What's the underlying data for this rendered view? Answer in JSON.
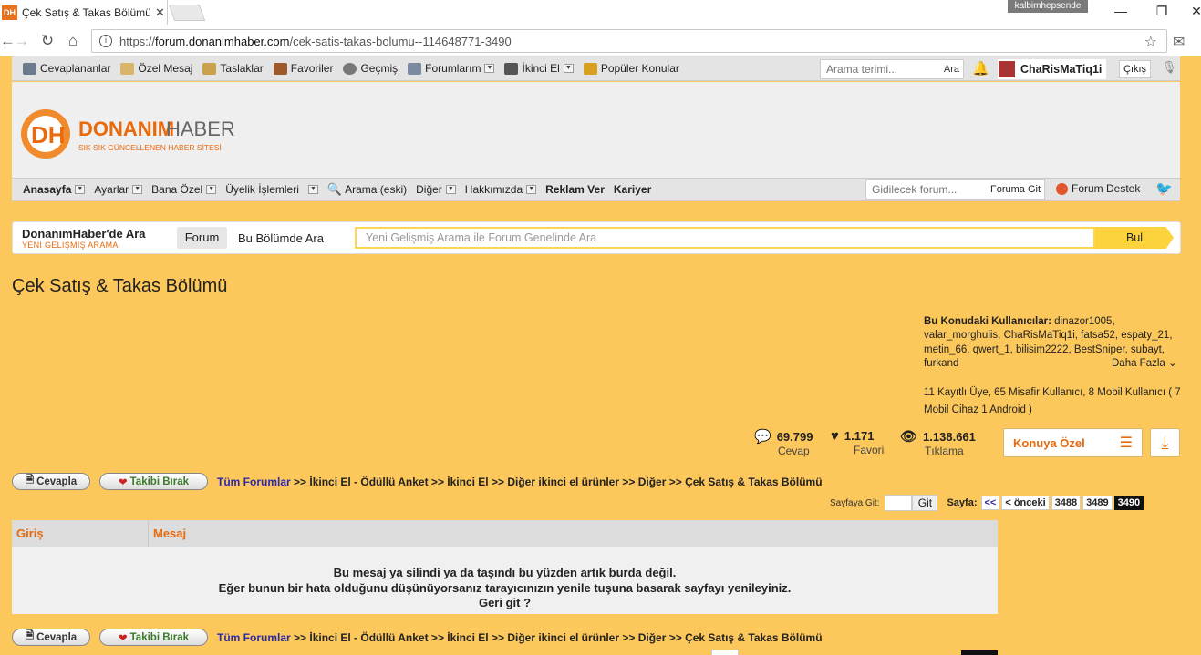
{
  "browser": {
    "tab_title": "Çek Satış & Takas Bölümü",
    "favicon_text": "DH",
    "profile_name": "kalbimhepsende",
    "url_scheme": "https://",
    "url_domain": "forum.donanimhaber.com",
    "url_path": "/cek-satis-takas-bolumu--114648771-3490"
  },
  "toplinks": [
    {
      "label": "Cevaplananlar"
    },
    {
      "label": "Özel Mesaj"
    },
    {
      "label": "Taslaklar"
    },
    {
      "label": "Favoriler"
    },
    {
      "label": "Geçmiş"
    },
    {
      "label": "Forumlarım"
    },
    {
      "label": "İkinci El"
    },
    {
      "label": "Popüler Konular"
    }
  ],
  "topbar": {
    "search_placeholder": "Arama terimi...",
    "search_button": "Ara",
    "username": "ChaRisMaTiq1i",
    "logout": "Çıkış"
  },
  "logo": {
    "brand_left": "DONANIM",
    "brand_right": "HABER",
    "tagline": "SIK SIK GÜNCELLENEN HABER SİTESİ"
  },
  "nav": [
    {
      "label": "Anasayfa"
    },
    {
      "label": "Ayarlar"
    },
    {
      "label": "Bana Özel"
    },
    {
      "label": "Üyelik İşlemleri"
    },
    {
      "label": "Arama (eski)"
    },
    {
      "label": "Diğer"
    },
    {
      "label": "Hakkımızda"
    },
    {
      "label": "Reklam Ver"
    },
    {
      "label": "Kariyer"
    }
  ],
  "goto_forum": {
    "placeholder": "Gidilecek forum...",
    "button": "Foruma Git"
  },
  "forum_support": "Forum Destek",
  "search": {
    "title": "DonanımHaber'de Ara",
    "subtitle": "YENİ GELİŞMİŞ ARAMA",
    "tab_forum": "Forum",
    "tab_section": "Bu Bölümde Ara",
    "placeholder": "Yeni Gelişmiş Arama ile Forum Genelinde Ara",
    "button": "Bul"
  },
  "page_title": "Çek Satış & Takas Bölümü",
  "online": {
    "label": "Bu Konudaki Kullanıcılar:",
    "users_text": "dinazor1005, valar_morghulis, ChaRisMaTiq1i, fatsa52, espaty_21, metin_66, qwert_1, bilisim2222, BestSniper, subayt, furkand",
    "more": "Daha Fazla",
    "counts": "11 Kayıtlı Üye, 65 Misafir Kullanıcı, 8 Mobil Kullanıcı ( 7 Mobil Cihaz 1 Android )"
  },
  "stats": {
    "replies_value": "69.799",
    "replies_label": "Cevap",
    "favorites_value": "1.171",
    "favorites_label": "Favori",
    "views_value": "1.138.661",
    "views_label": "Tıklama"
  },
  "topic_menu": "Konuya Özel",
  "actions": {
    "reply": "Cevapla",
    "unfollow": "Takibi Bırak"
  },
  "breadcrumb": {
    "first": "Tüm Forumlar",
    "rest": ">> İkinci El - Ödüllü Anket >> İkinci El >> Diğer ikinci el ürünler >> Diğer >> Çek Satış & Takas Bölümü"
  },
  "pagination": {
    "goto_label": "Sayfaya Git:",
    "goto_button": "Git",
    "label": "Sayfa:",
    "first": "<<",
    "prev": "< önceki",
    "pages": [
      "3488",
      "3489"
    ],
    "current": "3490"
  },
  "table": {
    "col1": "Giriş",
    "col2": "Mesaj",
    "message_line1": "Bu mesaj ya silindi ya da taşındı bu yüzden artık burda değil.",
    "message_line2": "Eğer bunun bir hata olduğunu düşünüyorsanız tarayıcınızın yenile tuşuna basarak sayfayı yenileyiniz.",
    "message_line3": "Geri git ?"
  },
  "colors": {
    "page_bg": "#FCC75B",
    "accent": "#E86A0C",
    "link_blue": "#2A2AA8"
  }
}
